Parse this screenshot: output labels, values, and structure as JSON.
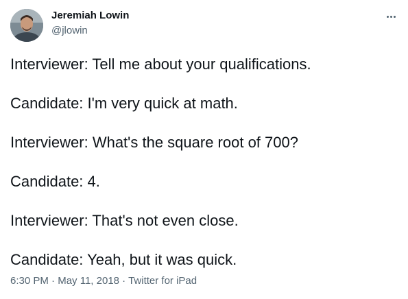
{
  "author": {
    "name": "Jeremiah Lowin",
    "handle": "@jlowin",
    "avatar": "avatar-photo"
  },
  "more_icon": "more-horizontal-icon",
  "tweet": {
    "lines": [
      "Interviewer: Tell me about your qualifications.",
      "Candidate: I'm very quick at math.",
      "Interviewer: What's the square root of 700?",
      "Candidate: 4.",
      "Interviewer: That's not even close.",
      "Candidate: Yeah, but it was quick."
    ]
  },
  "meta": {
    "time": "6:30 PM",
    "separator": " · ",
    "date": "May 11, 2018",
    "source": "Twitter for iPad"
  },
  "colors": {
    "text_primary": "#0f1419",
    "text_secondary": "#536471",
    "background": "#ffffff"
  }
}
